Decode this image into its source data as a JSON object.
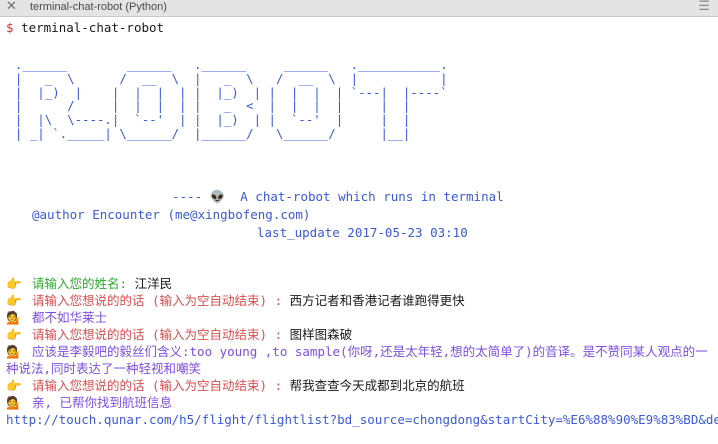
{
  "window": {
    "title": "terminal-chat-robot (Python)",
    "close_icon": "close-icon",
    "menu_icon": "menu-icon"
  },
  "terminal": {
    "prompt_symbol": "$",
    "command": "terminal-chat-robot",
    "banner_art": "  .______        ______   .______     ______   .___________.\n  |   _  \\      /  __  \\  |   _  \\   /  __  \\  |           |\n  |  |_)  |    |  |  |  | |  |_)  | |  |  |  | `---|  |----`\n  |      /     |  |  |  | |   _  <  |  |  |  |     |  |\n  |  |\\  \\----.|  `--'  | |  |_)  | |  `--'  |     |  |\n  | _| `._____| \\______/  |______/   \\______/      |__|",
    "tagline": "---- 👽  A chat-robot which runs in terminal",
    "author": "@author Encounter (me@xingbofeng.com)",
    "last_update": "last_update 2017-05-23 03:10",
    "messages": [
      {
        "icon": "👉",
        "label": "请输入您的姓名:",
        "text": "江洋民"
      },
      {
        "icon": "👉",
        "label": "请输入您想说的的话 (输入为空自动结束) :",
        "text": "西方记者和香港记者谁跑得更快"
      },
      {
        "icon": "💁",
        "text": "都不如华莱士"
      },
      {
        "icon": "👉",
        "label": "请输入您想说的的话 (输入为空自动结束) :",
        "text": "图样图森破"
      },
      {
        "icon": "💁",
        "text": "应该是李毅吧的毅丝们含义:too young ,to sample(你呀,还是太年轻,想的太简单了)的音译。是不赞同某人观点的一种说法,同时表达了一种轻视和嘲笑"
      },
      {
        "icon": "👉",
        "label": "请输入您想说的的话 (输入为空自动结束) :",
        "text": "帮我查查今天成都到北京的航班"
      },
      {
        "icon": "💁",
        "text": "亲, 已帮你找到航班信息"
      }
    ],
    "url": "http://touch.qunar.com/h5/flight/flightlist?bd_source=chongdong&startCity=%E6%88%90%E9%83%BD&destCity"
  },
  "colors": {
    "prompt": "#c23b3b",
    "banner": "#3b5ad8",
    "name_label": "#2ea82e",
    "input_label": "#d94f4f",
    "reply": "#7b4fe0"
  }
}
